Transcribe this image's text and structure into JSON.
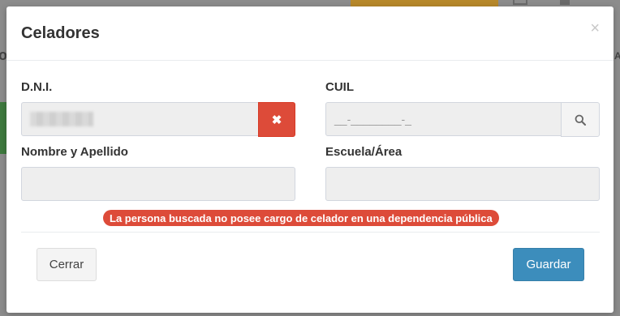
{
  "modal": {
    "title": "Celadores",
    "close_glyph": "×"
  },
  "form": {
    "dni": {
      "label": "D.N.I.",
      "value_redacted": true
    },
    "clear_icon": "times-icon",
    "clear_glyph": "✖",
    "cuil": {
      "label": "CUIL",
      "mask": "__-________-_"
    },
    "search_icon": "search-icon",
    "nombre": {
      "label": "Nombre y Apellido",
      "value": ""
    },
    "escuela": {
      "label": "Escuela/Área",
      "value": ""
    }
  },
  "error": {
    "message": "La persona buscada no posee cargo de celador en una dependencia pública",
    "color": "#dd4b39"
  },
  "footer": {
    "cancel_label": "Cerrar",
    "save_label": "Guardar",
    "accent_color": "#3c8dbc"
  }
}
